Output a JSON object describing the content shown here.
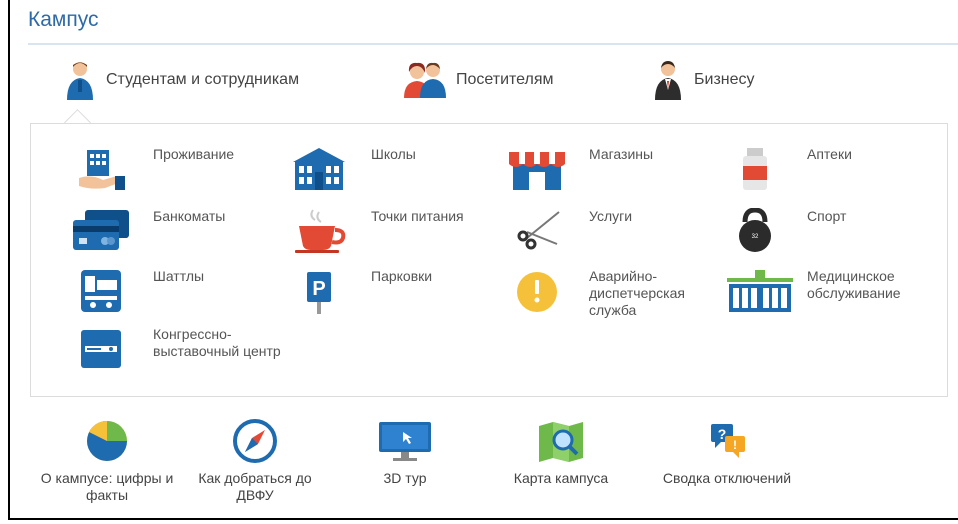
{
  "title": "Кампус",
  "tabs": [
    {
      "label": "Студентам и сотрудникам",
      "icon": "student-staff-icon",
      "active": true
    },
    {
      "label": "Посетителям",
      "icon": "visitors-icon"
    },
    {
      "label": "Бизнесу",
      "icon": "business-icon"
    }
  ],
  "grid": {
    "col1": [
      {
        "label": "Проживание",
        "icon": "housing-icon"
      },
      {
        "label": "Банкоматы",
        "icon": "atm-card-icon"
      },
      {
        "label": "Шаттлы",
        "icon": "shuttle-bus-icon"
      },
      {
        "label": "Конгрессно-выставочный центр",
        "icon": "congress-center-icon"
      }
    ],
    "col2": [
      {
        "label": "Школы",
        "icon": "school-building-icon"
      },
      {
        "label": "Точки питания",
        "icon": "coffee-cup-icon"
      },
      {
        "label": "Парковки",
        "icon": "parking-sign-icon"
      }
    ],
    "col3": [
      {
        "label": "Магазины",
        "icon": "shop-awning-icon"
      },
      {
        "label": "Услуги",
        "icon": "scissors-icon"
      },
      {
        "label": "Аварийно-диспетчерская служба",
        "icon": "emergency-alert-icon"
      }
    ],
    "col4": [
      {
        "label": "Аптеки",
        "icon": "pharmacy-bottle-icon"
      },
      {
        "label": "Спорт",
        "icon": "kettlebell-icon"
      },
      {
        "label": "Медицинское обслуживание",
        "icon": "medical-building-icon"
      }
    ]
  },
  "bottom": [
    {
      "label": "О кампусе: цифры и факты",
      "icon": "pie-chart-icon"
    },
    {
      "label": "Как добраться до ДВФУ",
      "icon": "compass-icon"
    },
    {
      "label": "3D тур",
      "icon": "monitor-icon"
    },
    {
      "label": "Карта кампуса",
      "icon": "map-search-icon"
    },
    {
      "label": "Сводка отключений",
      "icon": "outage-chat-icon"
    }
  ],
  "colors": {
    "title": "#2e6aa8",
    "blue": "#1e6bb0",
    "red": "#e24a35",
    "yellow": "#f5c13b"
  }
}
